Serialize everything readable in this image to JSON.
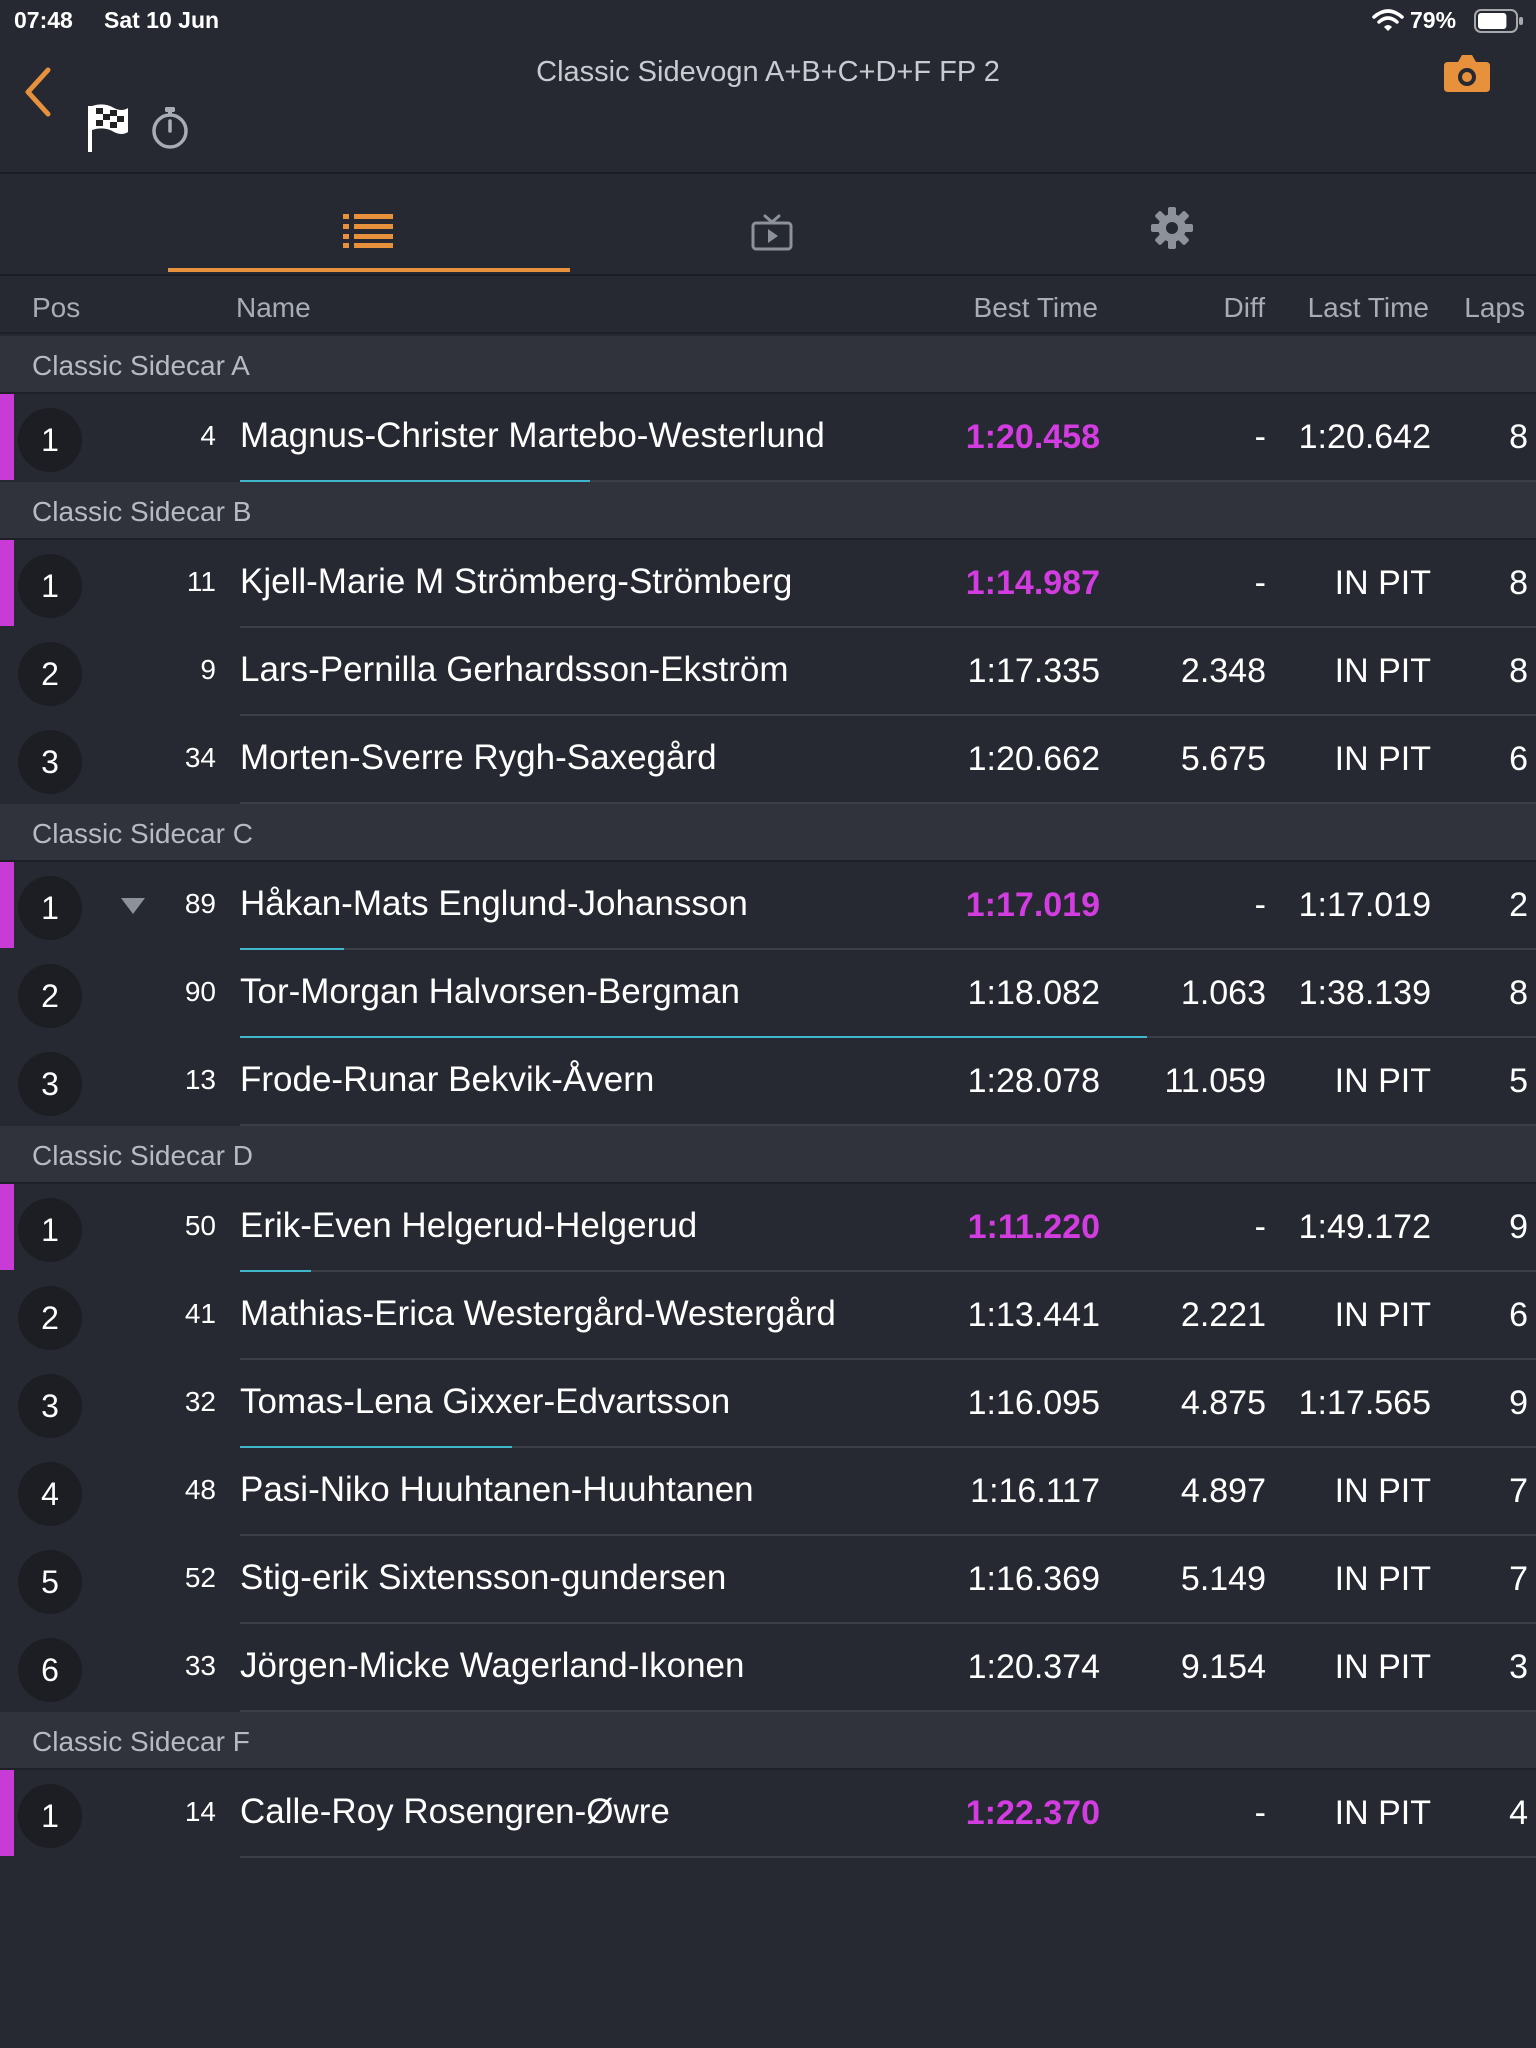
{
  "status": {
    "time": "07:48",
    "date": "Sat 10 Jun",
    "battery": "79%",
    "battery_level": 0.79
  },
  "header": {
    "title": "Classic Sidevogn A+B+C+D+F FP 2"
  },
  "colors": {
    "accent": "#e8913c",
    "fastest": "#d33ce0",
    "progress": "#3fb6cc"
  },
  "icons": {
    "back": "chevron-left-icon",
    "flag": "checkered-flag-icon",
    "stopwatch": "stopwatch-icon",
    "camera": "camera-icon"
  },
  "tabs": [
    {
      "icon": "list-icon",
      "active": true
    },
    {
      "icon": "tv-play-icon",
      "active": false
    },
    {
      "icon": "gear-icon",
      "active": false
    }
  ],
  "columns": {
    "pos": "Pos",
    "name": "Name",
    "best": "Best Time",
    "diff": "Diff",
    "last": "Last Time",
    "laps": "Laps"
  },
  "groups": [
    {
      "title": "Classic Sidecar A",
      "rows": [
        {
          "pos": "1",
          "num": "4",
          "name": "Magnus-Christer Martebo-Westerlund",
          "best": "1:20.458",
          "diff": "-",
          "last": "1:20.642",
          "laps": "8",
          "leader": true,
          "progress": 0.27
        }
      ]
    },
    {
      "title": "Classic Sidecar B",
      "rows": [
        {
          "pos": "1",
          "num": "11",
          "name": "Kjell-Marie M Strömberg-Strömberg",
          "best": "1:14.987",
          "diff": "-",
          "last": "IN PIT",
          "laps": "8",
          "leader": true
        },
        {
          "pos": "2",
          "num": "9",
          "name": "Lars-Pernilla Gerhardsson-Ekström",
          "best": "1:17.335",
          "diff": "2.348",
          "last": "IN PIT",
          "laps": "8"
        },
        {
          "pos": "3",
          "num": "34",
          "name": "Morten-Sverre Rygh-Saxegård",
          "best": "1:20.662",
          "diff": "5.675",
          "last": "IN PIT",
          "laps": "6"
        }
      ]
    },
    {
      "title": "Classic Sidecar C",
      "rows": [
        {
          "pos": "1",
          "num": "89",
          "name": "Håkan-Mats Englund-Johansson",
          "best": "1:17.019",
          "diff": "-",
          "last": "1:17.019",
          "laps": "2",
          "leader": true,
          "marker": true,
          "progress": 0.08
        },
        {
          "pos": "2",
          "num": "90",
          "name": "Tor-Morgan Halvorsen-Bergman",
          "best": "1:18.082",
          "diff": "1.063",
          "last": "1:38.139",
          "laps": "8",
          "progress": 0.7
        },
        {
          "pos": "3",
          "num": "13",
          "name": "Frode-Runar Bekvik-Åvern",
          "best": "1:28.078",
          "diff": "11.059",
          "last": "IN PIT",
          "laps": "5"
        }
      ]
    },
    {
      "title": "Classic Sidecar D",
      "rows": [
        {
          "pos": "1",
          "num": "50",
          "name": "Erik-Even Helgerud-Helgerud",
          "best": "1:11.220",
          "diff": "-",
          "last": "1:49.172",
          "laps": "9",
          "leader": true,
          "progress": 0.055
        },
        {
          "pos": "2",
          "num": "41",
          "name": "Mathias-Erica Westergård-Westergård",
          "best": "1:13.441",
          "diff": "2.221",
          "last": "IN PIT",
          "laps": "6"
        },
        {
          "pos": "3",
          "num": "32",
          "name": "Tomas-Lena Gixxer-Edvartsson",
          "best": "1:16.095",
          "diff": "4.875",
          "last": "1:17.565",
          "laps": "9",
          "progress": 0.21
        },
        {
          "pos": "4",
          "num": "48",
          "name": "Pasi-Niko Huuhtanen-Huuhtanen",
          "best": "1:16.117",
          "diff": "4.897",
          "last": "IN PIT",
          "laps": "7"
        },
        {
          "pos": "5",
          "num": "52",
          "name": "Stig-erik Sixtensson-gundersen",
          "best": "1:16.369",
          "diff": "5.149",
          "last": "IN PIT",
          "laps": "7"
        },
        {
          "pos": "6",
          "num": "33",
          "name": "Jörgen-Micke Wagerland-Ikonen",
          "best": "1:20.374",
          "diff": "9.154",
          "last": "IN PIT",
          "laps": "3"
        }
      ]
    },
    {
      "title": "Classic Sidecar F",
      "rows": [
        {
          "pos": "1",
          "num": "14",
          "name": "Calle-Roy Rosengren-Øwre",
          "best": "1:22.370",
          "diff": "-",
          "last": "IN PIT",
          "laps": "4",
          "leader": true
        }
      ]
    }
  ]
}
